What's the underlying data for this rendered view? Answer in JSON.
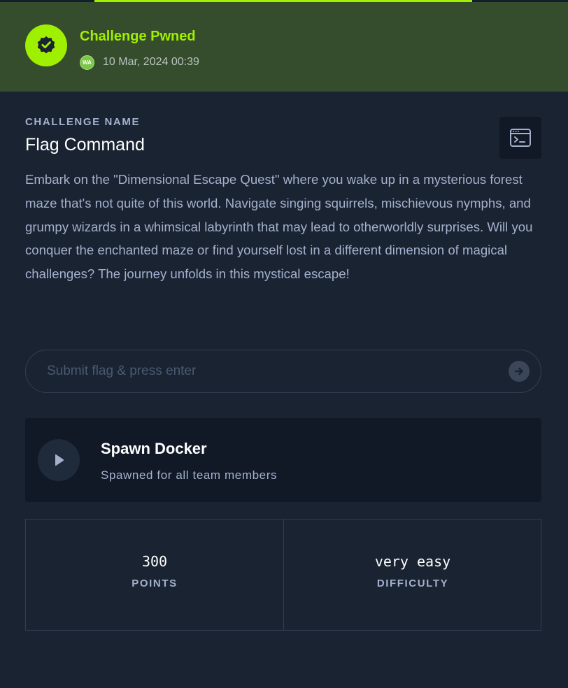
{
  "banner": {
    "title": "Challenge Pwned",
    "avatar_initials": "WA",
    "date": "10 Mar, 2024 00:39",
    "icon": "verified-badge-icon",
    "accent_color": "#9fef00",
    "background_color": "#354d2c"
  },
  "challenge": {
    "section_label": "CHALLENGE NAME",
    "name": "Flag Command",
    "terminal_icon": "terminal-icon",
    "description": "Embark on the \"Dimensional Escape Quest\" where you wake up in a mysterious forest maze that's not quite of this world. Navigate singing squirrels, mischievous nymphs, and grumpy wizards in a whimsical labyrinth that may lead to otherworldly surprises. Will you conquer the enchanted maze or find yourself lost in a different dimension of magical challenges? The journey unfolds in this mystical escape!"
  },
  "flag_form": {
    "placeholder": "Submit flag & press enter",
    "value": "",
    "submit_icon": "arrow-right-circle-icon"
  },
  "spawn": {
    "title": "Spawn Docker",
    "subtitle": "Spawned for all team members",
    "icon": "play-icon"
  },
  "stats": {
    "points_value": "300",
    "points_label": "POINTS",
    "difficulty_value": "very easy",
    "difficulty_label": "DIFFICULTY"
  }
}
